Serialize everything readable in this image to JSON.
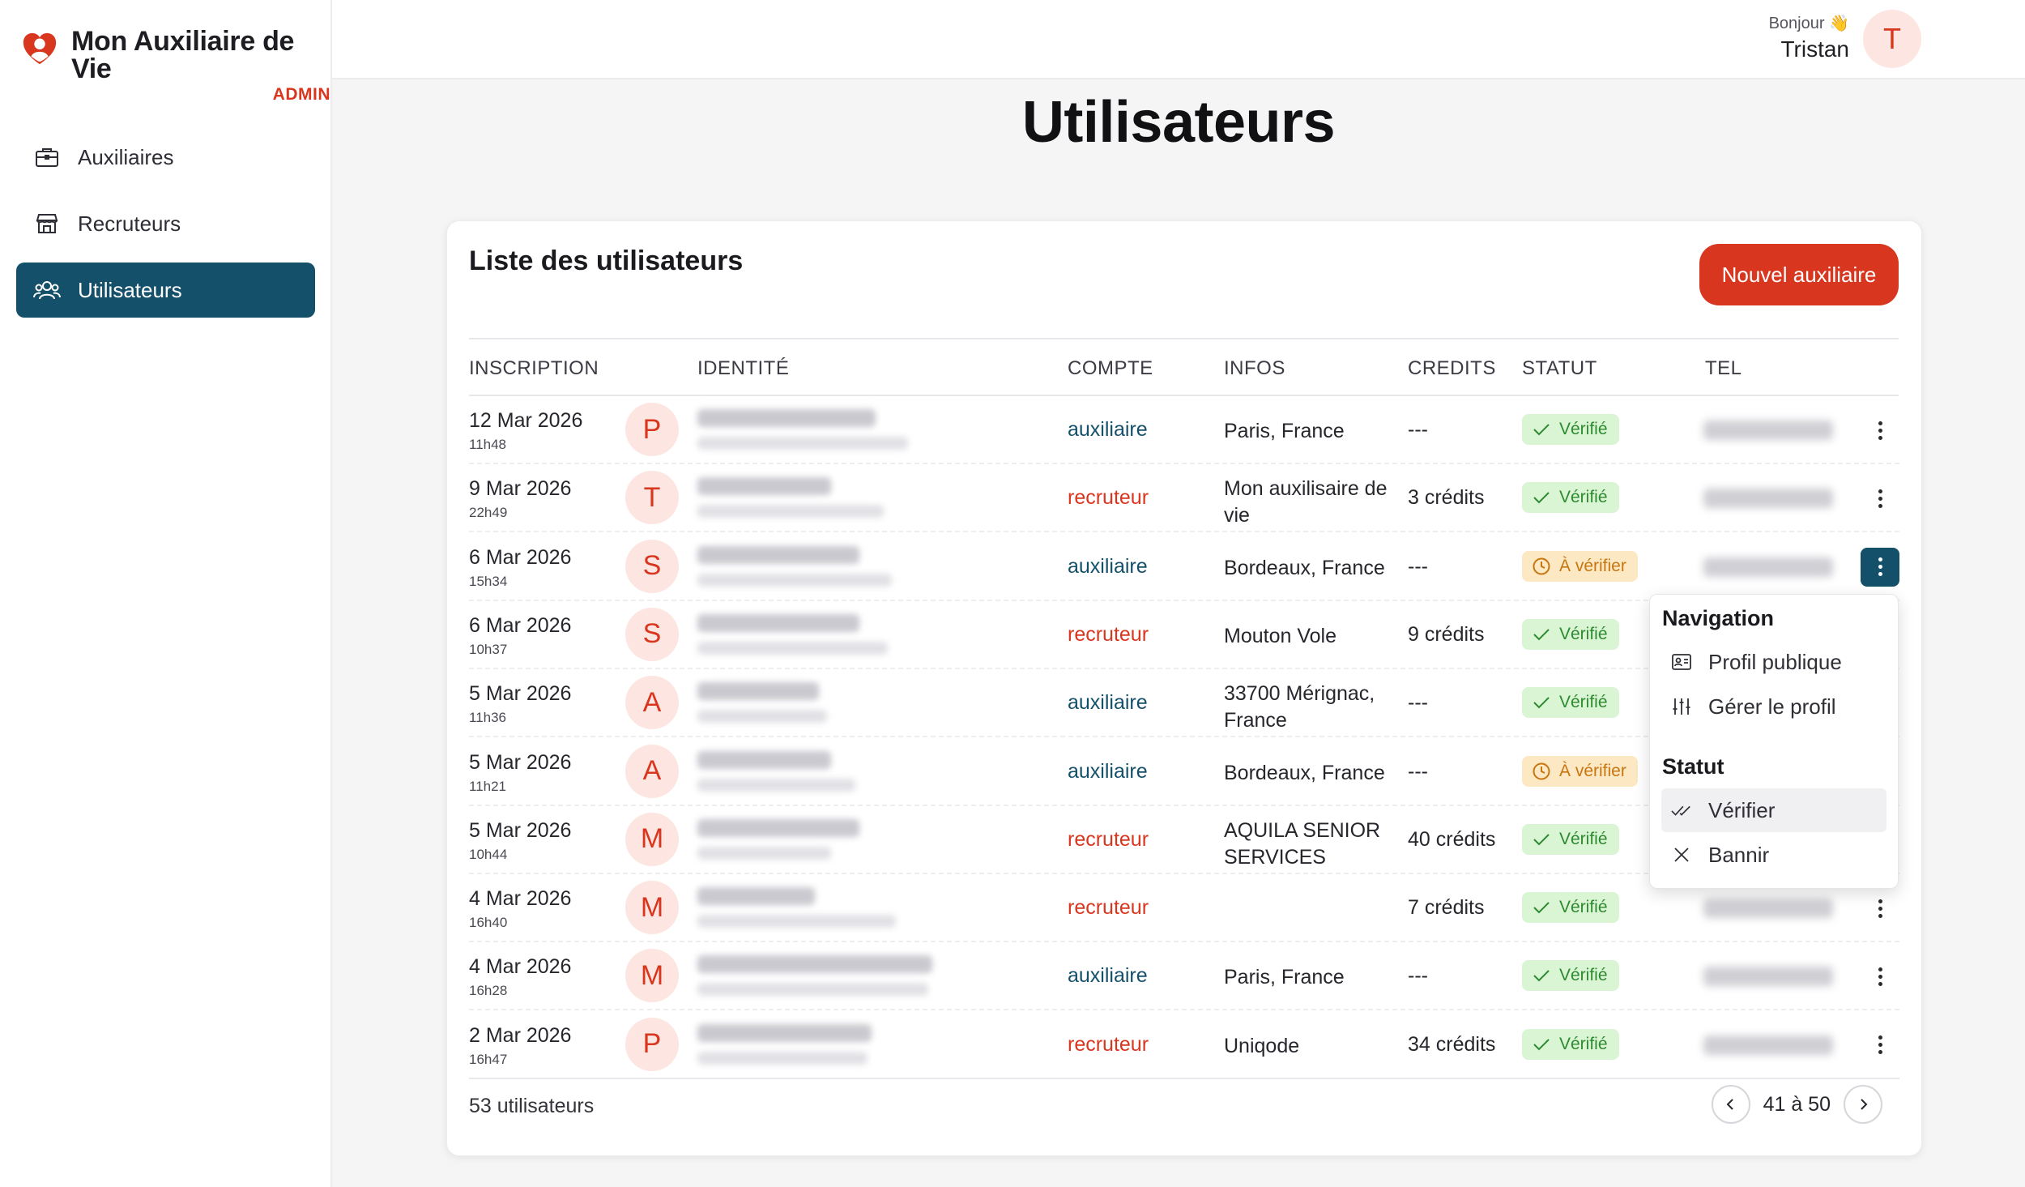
{
  "app": {
    "title": "Mon Auxiliaire de Vie",
    "subtitle": "ADMIN",
    "brand_color": "#d8361f",
    "primary_color": "#15506b"
  },
  "sidebar": {
    "items": [
      {
        "label": "Auxiliaires",
        "icon": "briefcase-icon",
        "active": false
      },
      {
        "label": "Recruteurs",
        "icon": "store-icon",
        "active": false
      },
      {
        "label": "Utilisateurs",
        "icon": "users-icon",
        "active": true
      }
    ]
  },
  "header": {
    "greeting": "Bonjour 👋",
    "user_name": "Tristan",
    "avatar_initial": "T"
  },
  "page": {
    "title": "Utilisateurs"
  },
  "card": {
    "title": "Liste des utilisateurs",
    "new_button": "Nouvel auxiliaire"
  },
  "table": {
    "columns": [
      "INSCRIPTION",
      "IDENTITÉ",
      "COMPTE",
      "INFOS",
      "CREDITS",
      "STATUT",
      "TEL"
    ],
    "rows": [
      {
        "date": "12 Mar 2026",
        "time": "11h48",
        "initial": "P",
        "compte": "auxiliaire",
        "infos": "Paris, France",
        "credits": "---",
        "statut": "Vérifié",
        "status_type": "ok"
      },
      {
        "date": "9 Mar 2026",
        "time": "22h49",
        "initial": "T",
        "compte": "recruteur",
        "infos": "Mon auxilisaire de vie",
        "credits": "3 crédits",
        "statut": "Vérifié",
        "status_type": "ok"
      },
      {
        "date": "6 Mar 2026",
        "time": "15h34",
        "initial": "S",
        "compte": "auxiliaire",
        "infos": "Bordeaux, France",
        "credits": "---",
        "statut": "À vérifier",
        "status_type": "warn"
      },
      {
        "date": "6 Mar 2026",
        "time": "10h37",
        "initial": "S",
        "compte": "recruteur",
        "infos": "Mouton Vole",
        "credits": "9 crédits",
        "statut": "Vérifié",
        "status_type": "ok"
      },
      {
        "date": "5 Mar 2026",
        "time": "11h36",
        "initial": "A",
        "compte": "auxiliaire",
        "infos": "33700 Mérignac, France",
        "credits": "---",
        "statut": "Vérifié",
        "status_type": "ok"
      },
      {
        "date": "5 Mar 2026",
        "time": "11h21",
        "initial": "A",
        "compte": "auxiliaire",
        "infos": "Bordeaux, France",
        "credits": "---",
        "statut": "À vérifier",
        "status_type": "warn"
      },
      {
        "date": "5 Mar 2026",
        "time": "10h44",
        "initial": "M",
        "compte": "recruteur",
        "infos": "AQUILA SENIOR SERVICES",
        "credits": "40 crédits",
        "statut": "Vérifié",
        "status_type": "ok"
      },
      {
        "date": "4 Mar 2026",
        "time": "16h40",
        "initial": "M",
        "compte": "recruteur",
        "infos": "",
        "credits": "7 crédits",
        "statut": "Vérifié",
        "status_type": "ok"
      },
      {
        "date": "4 Mar 2026",
        "time": "16h28",
        "initial": "M",
        "compte": "auxiliaire",
        "infos": "Paris, France",
        "credits": "---",
        "statut": "Vérifié",
        "status_type": "ok"
      },
      {
        "date": "2 Mar 2026",
        "time": "16h47",
        "initial": "P",
        "compte": "recruteur",
        "infos": "Uniqode",
        "credits": "34 crédits",
        "statut": "Vérifié",
        "status_type": "ok"
      }
    ]
  },
  "footer": {
    "count": "53 utilisateurs",
    "range": "41 à 50"
  },
  "menu": {
    "nav_heading": "Navigation",
    "profile_public": "Profil publique",
    "manage_profile": "Gérer le profil",
    "status_heading": "Statut",
    "verify": "Vérifier",
    "ban": "Bannir"
  }
}
